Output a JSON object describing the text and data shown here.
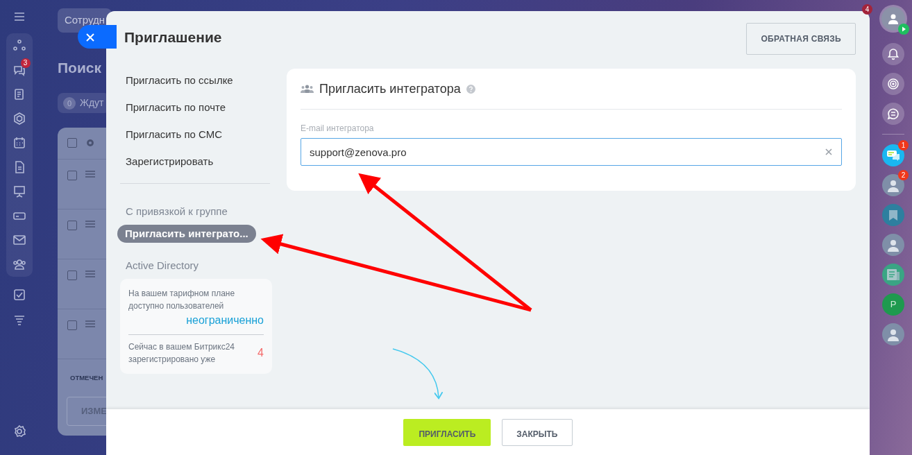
{
  "left_sidebar": {
    "chat_badge": "3"
  },
  "background_page": {
    "search_chip": "Сотрудн",
    "heading": "Поиск",
    "filter_chip": {
      "count": "0",
      "label": "Ждут"
    },
    "rows": [
      {
        "checked": false
      },
      {
        "checked": false
      },
      {
        "checked": false
      },
      {
        "checked": false
      }
    ],
    "header_checked": false,
    "footer_label": "ОТМЕЧЕН",
    "footer_button": "ИЗМЕ"
  },
  "right_rail": {
    "profile_badge": "4",
    "apps": [
      {
        "kind": "chat",
        "badge": "1"
      },
      {
        "kind": "avatar",
        "badge": "2"
      },
      {
        "kind": "bookmark"
      },
      {
        "kind": "avatar"
      },
      {
        "kind": "news"
      },
      {
        "kind": "letter",
        "letter": "Р"
      },
      {
        "kind": "avatar"
      }
    ]
  },
  "modal": {
    "title": "Приглашение",
    "feedback_button": "ОБРАТНАЯ СВЯЗЬ",
    "menu": [
      {
        "label": "Пригласить по ссылке",
        "selected": false
      },
      {
        "label": "Пригласить по почте",
        "selected": false
      },
      {
        "label": "Пригласить по СМС",
        "selected": false
      },
      {
        "label": "Зарегистрировать",
        "selected": false
      }
    ],
    "menu_extra": [
      {
        "label": "С привязкой к группе",
        "selected": false
      },
      {
        "label": "Пригласить интеграто...",
        "selected": true
      },
      {
        "label": "Active Directory",
        "selected": false
      }
    ],
    "plan_info": {
      "limit_text": "На вашем тарифном плане доступно пользователей",
      "limit_value": "неограниченно",
      "count_text": "Сейчас в вашем Битрикс24 зарегистрировано уже",
      "count_value": "4"
    },
    "panel": {
      "title": "Пригласить интегратора",
      "field_label": "E-mail интегратора",
      "field_value": "support@zenova.pro"
    },
    "buttons": [
      {
        "kind": "primary",
        "label": "ПРИГЛАСИТЬ"
      },
      {
        "kind": "secondary",
        "label": "ЗАКРЫТЬ"
      }
    ]
  }
}
